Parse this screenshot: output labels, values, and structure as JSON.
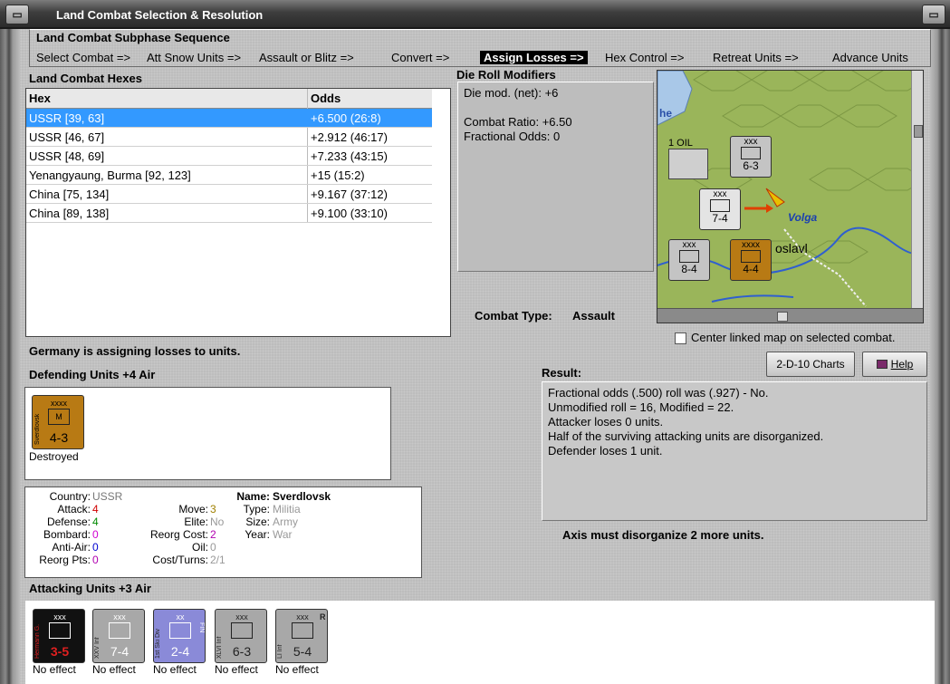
{
  "window": {
    "title": "Land Combat Selection & Resolution"
  },
  "sequence": {
    "title": "Land Combat Subphase Sequence",
    "steps": [
      {
        "label": "Select Combat =>",
        "active": false
      },
      {
        "label": "Att Snow Units =>",
        "active": false
      },
      {
        "label": "Assault or Blitz =>",
        "active": false
      },
      {
        "label": "Convert =>",
        "active": false
      },
      {
        "label": "Assign Losses =>",
        "active": true
      },
      {
        "label": "Hex Control =>",
        "active": false
      },
      {
        "label": "Retreat Units =>",
        "active": false
      },
      {
        "label": "Advance Units",
        "active": false
      }
    ]
  },
  "hexes": {
    "title": "Land Combat Hexes",
    "columns": [
      "Hex",
      "Odds"
    ],
    "rows": [
      {
        "hex": "USSR [39, 63]",
        "odds": "+6.500 (26:8)",
        "selected": true
      },
      {
        "hex": "USSR [46, 67]",
        "odds": "+2.912 (46:17)",
        "selected": false
      },
      {
        "hex": "USSR [48, 69]",
        "odds": "+7.233 (43:15)",
        "selected": false
      },
      {
        "hex": "Yenangyaung, Burma [92, 123]",
        "odds": "+15 (15:2)",
        "selected": false
      },
      {
        "hex": "China [75, 134]",
        "odds": "+9.167 (37:12)",
        "selected": false
      },
      {
        "hex": "China [89, 138]",
        "odds": "+9.100 (33:10)",
        "selected": false
      }
    ]
  },
  "modifiers": {
    "title": "Die Roll Modifiers",
    "lines": [
      "Die mod. (net): +6",
      "Combat Ratio: +6.50",
      "Fractional Odds: 0"
    ]
  },
  "map": {
    "labels": {
      "he": "he",
      "oil": "1 OIL",
      "volga": "Volga",
      "city": "oslavl"
    },
    "counters": [
      {
        "size": "xxx",
        "value": "6-3",
        "id": "2"
      },
      {
        "size": "xxx",
        "value": "7-4",
        "id": "3"
      },
      {
        "size": "xxx",
        "value": "8-4",
        "id": "4"
      },
      {
        "size": "xxxx",
        "value": "4-4",
        "id": "4"
      }
    ],
    "center_checkbox": {
      "label": "Center linked map on selected combat.",
      "checked": false
    }
  },
  "combat_type": {
    "label": "Combat Type:",
    "value": "Assault"
  },
  "status_message": "Germany is assigning losses to units.",
  "defending": {
    "title": "Defending Units +4 Air",
    "units": [
      {
        "name": "Sverdlovsk",
        "size": "xxxx",
        "type": "M",
        "value": "4-3",
        "color": "#b87a14",
        "status": "Destroyed"
      }
    ]
  },
  "unit_details": {
    "country": {
      "label": "Country:",
      "value": "USSR"
    },
    "attack": {
      "label": "Attack:",
      "value": "4"
    },
    "defense": {
      "label": "Defense:",
      "value": "4"
    },
    "bombard": {
      "label": "Bombard:",
      "value": "0"
    },
    "anti_air": {
      "label": "Anti-Air:",
      "value": "0"
    },
    "reorg_pts": {
      "label": "Reorg Pts:",
      "value": "0"
    },
    "move": {
      "label": "Move:",
      "value": "3"
    },
    "elite": {
      "label": "Elite:",
      "value": "No"
    },
    "reorg_cost": {
      "label": "Reorg Cost:",
      "value": "2"
    },
    "oil": {
      "label": "Oil:",
      "value": "0"
    },
    "cost_turns": {
      "label": "Cost/Turns:",
      "value": "2/1"
    },
    "name": {
      "label": "Name:",
      "value": "Sverdlovsk"
    },
    "type": {
      "label": "Type:",
      "value": "Militia"
    },
    "size": {
      "label": "Size:",
      "value": "Army"
    },
    "year": {
      "label": "Year:",
      "value": "War"
    }
  },
  "result": {
    "title": "Result:",
    "lines": [
      "Fractional odds (.500) roll was (.927)  - No.",
      "Unmodified roll = 16, Modified = 22.",
      "Attacker loses 0 units.",
      "Half of the surviving attacking units are disorganized.",
      "Defender loses 1 unit."
    ],
    "note": "Axis must disorganize 2 more units."
  },
  "buttons": {
    "charts": "2-D-10 Charts",
    "help": "Help"
  },
  "attacking": {
    "title": "Attacking Units +3 Air",
    "units": [
      {
        "name": "Hermann G.",
        "size": "xxx",
        "value": "3-5",
        "color": "#111111",
        "status": "No effect"
      },
      {
        "name": "XXV Inf",
        "size": "xxx",
        "value": "7-4",
        "color": "#a8a8a8",
        "status": "No effect"
      },
      {
        "name": "1st Ski Div",
        "size": "xx",
        "value": "2-4",
        "color": "#8a8ad8",
        "status": "No effect",
        "tag": "FIN"
      },
      {
        "name": "XLVI Inf",
        "size": "xxx",
        "value": "6-3",
        "color": "#a8a8a8",
        "status": "No effect"
      },
      {
        "name": "LI Inf",
        "size": "xxx",
        "value": "5-4",
        "color": "#a8a8a8",
        "status": "No effect",
        "tag": "R"
      }
    ]
  }
}
